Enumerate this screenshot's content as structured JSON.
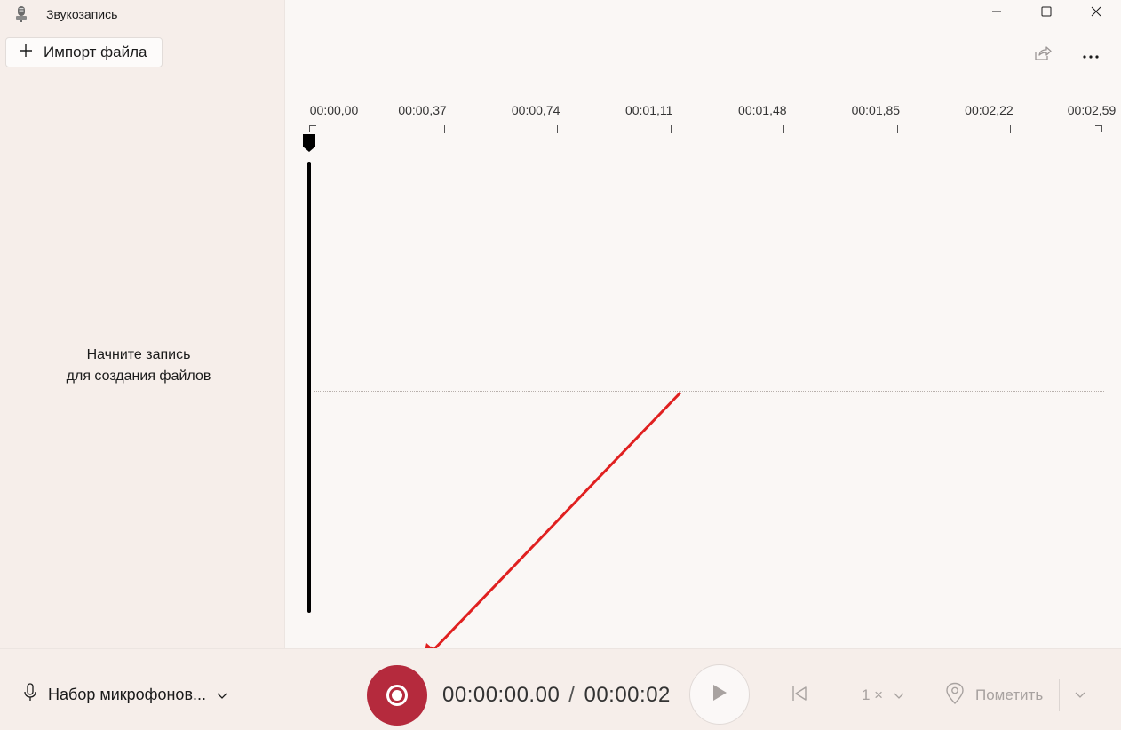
{
  "app": {
    "title": "Звукозапись"
  },
  "sidebar": {
    "import_label": "Импорт файла",
    "empty_line1": "Начните запись",
    "empty_line2": "для создания файлов"
  },
  "timeline": {
    "ticks": [
      "00:00,00",
      "00:00,37",
      "00:00,74",
      "00:01,11",
      "00:01,48",
      "00:01,85",
      "00:02,22",
      "00:02,59"
    ]
  },
  "bottom": {
    "mic_label": "Набор микрофонов...",
    "current_time": "00:00:00.00",
    "separator": "/",
    "total_time": "00:00:02",
    "speed_label": "1 ×",
    "mark_label": "Пометить"
  },
  "colors": {
    "record": "#b52a3d",
    "annotation_arrow": "#e02020"
  },
  "icons": {
    "app": "microphone-app-icon",
    "import": "plus-icon",
    "minimize": "minimize-icon",
    "maximize": "maximize-icon",
    "close": "close-icon",
    "share": "share-icon",
    "more": "more-icon",
    "mic": "microphone-icon",
    "chevron": "chevron-down-icon",
    "record": "record-icon",
    "play": "play-icon",
    "skip": "skip-back-icon",
    "mark": "location-pin-icon"
  }
}
